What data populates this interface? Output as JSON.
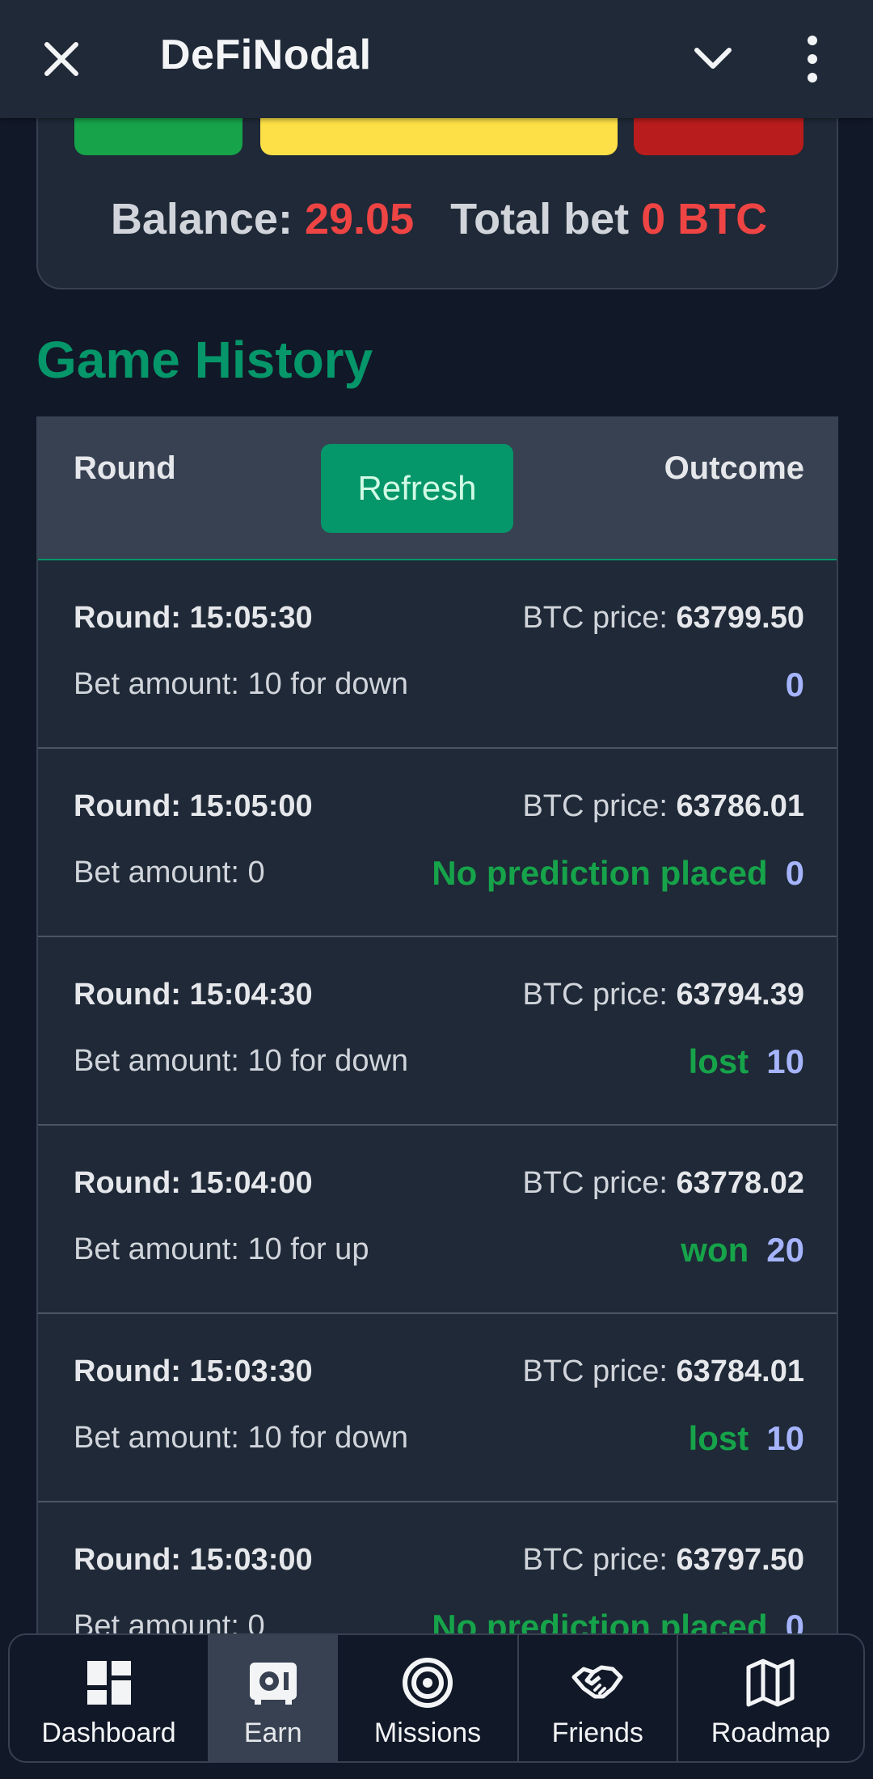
{
  "header": {
    "title": "DeFiNodal",
    "icons": [
      "close-icon",
      "chevron-down-icon",
      "more-vertical-icon"
    ]
  },
  "bet_panel": {
    "balance_label": "Balance:",
    "balance_value": "29.05",
    "total_bet_label": "Total bet",
    "total_bet_value": "0 BTC",
    "colors": {
      "up": "#16a34a",
      "neutral": "#fde047",
      "down": "#b91c1c",
      "value": "#ef4444"
    }
  },
  "history": {
    "title": "Game History",
    "col_round": "Round",
    "refresh_label": "Refresh",
    "col_outcome": "Outcome",
    "price_label": "BTC price:",
    "rows": [
      {
        "round": "Round: 15:05:30",
        "price": "63799.50",
        "bet": "Bet amount: 10 for down",
        "status": "",
        "amount": "0"
      },
      {
        "round": "Round: 15:05:00",
        "price": "63786.01",
        "bet": "Bet amount: 0",
        "status": "No prediction placed",
        "amount": "0"
      },
      {
        "round": "Round: 15:04:30",
        "price": "63794.39",
        "bet": "Bet amount: 10 for down",
        "status": "lost",
        "amount": "10"
      },
      {
        "round": "Round: 15:04:00",
        "price": "63778.02",
        "bet": "Bet amount: 10 for up",
        "status": "won",
        "amount": "20"
      },
      {
        "round": "Round: 15:03:30",
        "price": "63784.01",
        "bet": "Bet amount: 10 for down",
        "status": "lost",
        "amount": "10"
      },
      {
        "round": "Round: 15:03:00",
        "price": "63797.50",
        "bet": "Bet amount: 0",
        "status": "No prediction placed",
        "amount": "0"
      }
    ]
  },
  "bottom_nav": {
    "items": [
      {
        "label": "Dashboard",
        "icon": "dashboard-icon",
        "active": false
      },
      {
        "label": "Earn",
        "icon": "safe-icon",
        "active": true
      },
      {
        "label": "Missions",
        "icon": "target-icon",
        "active": false
      },
      {
        "label": "Friends",
        "icon": "handshake-icon",
        "active": false
      },
      {
        "label": "Roadmap",
        "icon": "map-icon",
        "active": false
      }
    ]
  }
}
